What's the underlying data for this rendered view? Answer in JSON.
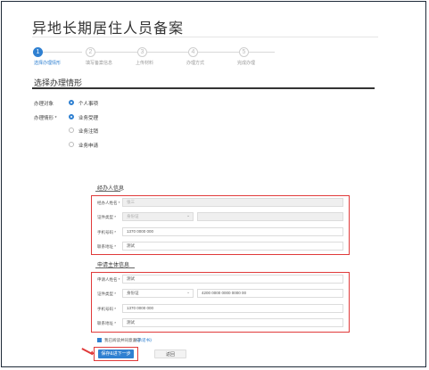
{
  "page": {
    "title": "异地长期居住人员备案"
  },
  "steps": [
    {
      "number": "1",
      "label": "选择办理情形",
      "state": "active"
    },
    {
      "number": "2",
      "label": "填写备案信息",
      "state": "todo"
    },
    {
      "number": "3",
      "label": "上传材料",
      "state": "todo"
    },
    {
      "number": "4",
      "label": "办理方式",
      "state": "todo"
    },
    {
      "number": "5",
      "label": "完成办理",
      "state": "todo"
    }
  ],
  "section": {
    "title": "选择办理情形",
    "handle_object": {
      "label": "办理对象",
      "options": [
        {
          "label": "个人事项",
          "selected": true
        }
      ]
    },
    "handle_case": {
      "label": "办理情形 *",
      "options": [
        {
          "label": "业务受理",
          "selected": true
        },
        {
          "label": "业务注销",
          "selected": false
        },
        {
          "label": "业务申请",
          "selected": false
        }
      ]
    }
  },
  "handler_info": {
    "title": "经办人信息",
    "fields": [
      {
        "label": "经办人姓名 *",
        "value": "张三",
        "disabled": true
      },
      {
        "label": "证件类型 *",
        "value": "身份证",
        "disabled": true,
        "extra_value": ""
      },
      {
        "label": "手机号码 *",
        "value": "1370 0000 000",
        "disabled": false
      },
      {
        "label": "联系地址 *",
        "value": "测试",
        "disabled": false
      }
    ]
  },
  "applicant_info": {
    "title": "申请主体信息",
    "fields": [
      {
        "label": "申请人姓名 *",
        "value": "测试",
        "disabled": false
      },
      {
        "label": "证件类型 *",
        "value": "身份证",
        "disabled": false,
        "extra_value": "4200 0000 0000 0000 00"
      },
      {
        "label": "手机号码 *",
        "value": "1370 0000 000",
        "disabled": false
      },
      {
        "label": "联系地址 *",
        "value": "测试",
        "disabled": false
      }
    ]
  },
  "agreement": {
    "text": "我已阅读并同意遵守",
    "link": "《承诺书》"
  },
  "buttons": {
    "next": "保存&进下一步",
    "back": "返回"
  },
  "colors": {
    "accent": "#2f80d1",
    "highlight": "#e03a3a"
  }
}
